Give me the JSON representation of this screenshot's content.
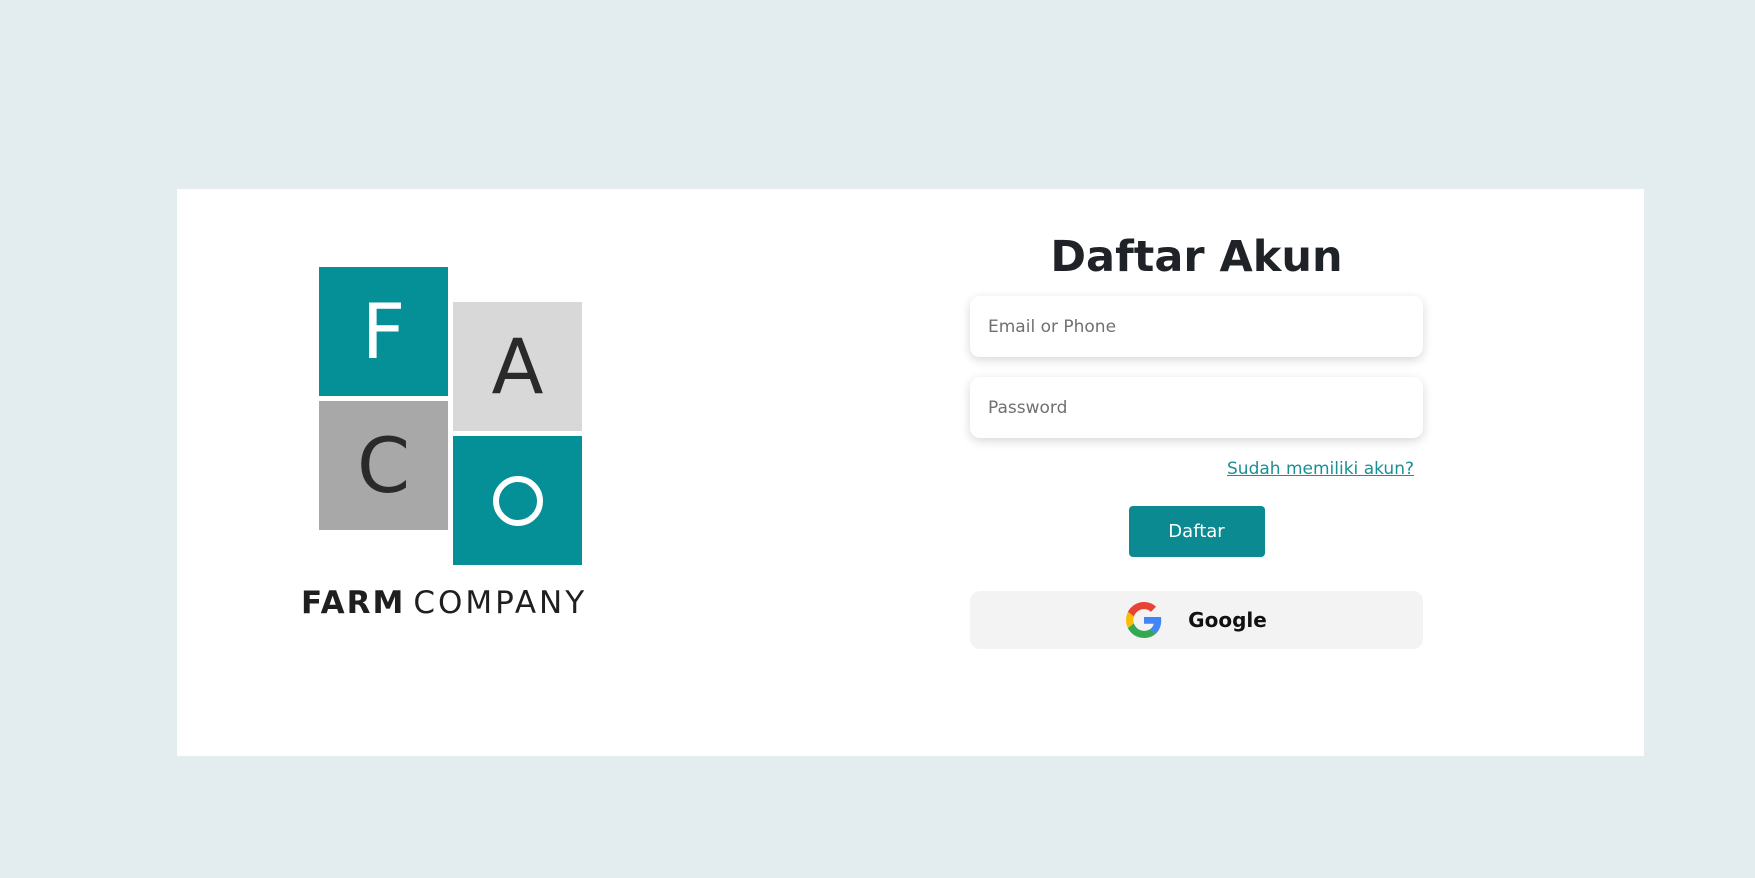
{
  "logo": {
    "tiles": {
      "f": "F",
      "a": "A",
      "c": "C",
      "o": "O"
    },
    "brand_bold": "FARM",
    "brand_regular": "COMPANY"
  },
  "form": {
    "title": "Daftar Akun",
    "email_placeholder": "Email or Phone",
    "password_placeholder": "Password",
    "login_link": "Sudah memiliki akun?",
    "submit_label": "Daftar",
    "google_label": "Google"
  },
  "colors": {
    "page_background": "#e3ecef",
    "card_background": "#ffffff",
    "accent": "#049096",
    "button": "#0b8a91",
    "link": "#1a8f95",
    "google_button": "#f3f3f3"
  },
  "icons": {
    "google": "google-g-icon"
  }
}
